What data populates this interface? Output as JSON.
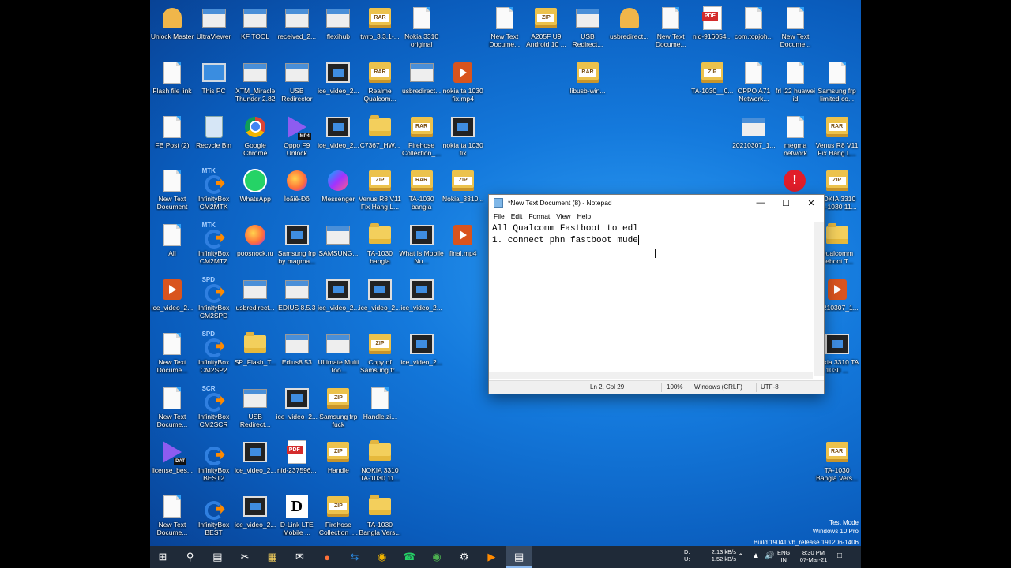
{
  "desktop": {
    "icons": [
      {
        "label": "Unlock Master",
        "icon": "unlock-master-icon",
        "type": "user"
      },
      {
        "label": "UltraViewer",
        "icon": "ultraviewer-icon",
        "type": "monitor"
      },
      {
        "label": "KF TOOL",
        "icon": "kf-tool-icon",
        "type": "tool"
      },
      {
        "label": "received_2...",
        "icon": "image-file-icon",
        "type": "image"
      },
      {
        "label": "flexihub",
        "icon": "flexihub-icon",
        "type": "tool"
      },
      {
        "label": "twrp_3.3.1-...",
        "icon": "archive-icon",
        "type": "arch"
      },
      {
        "label": "Nokia 3310 original",
        "icon": "document-icon",
        "type": "doc"
      },
      {
        "label": "New Text Docume...",
        "icon": "text-document-icon",
        "type": "doc"
      },
      {
        "label": "A205F U9 Android 10 ...",
        "icon": "zip-archive-icon",
        "type": "zip"
      },
      {
        "label": "USB Redirect...",
        "icon": "usb-redirector-icon",
        "type": "tool"
      },
      {
        "label": "usbredirect...",
        "icon": "usbredirector-icon",
        "type": "user"
      },
      {
        "label": "New Text Docume...",
        "icon": "text-document-icon",
        "type": "doc"
      },
      {
        "label": "nid-916054...",
        "icon": "pdf-icon",
        "type": "pdf"
      },
      {
        "label": "com.topjoh...",
        "icon": "document-icon",
        "type": "doc"
      },
      {
        "label": "New Text Docume...",
        "icon": "text-document-icon",
        "type": "doc"
      },
      {
        "label": "Flash file link",
        "icon": "text-document-icon",
        "type": "doc"
      },
      {
        "label": "This PC",
        "icon": "this-pc-icon",
        "type": "pc"
      },
      {
        "label": "XTM_Miracle Thunder 2.82",
        "icon": "miracle-thunder-icon",
        "type": "tool"
      },
      {
        "label": "USB Redirector",
        "icon": "usb-redirector-icon",
        "type": "tool"
      },
      {
        "label": "ice_video_2...",
        "icon": "video-icon",
        "type": "vid"
      },
      {
        "label": "Realme Qualcom...",
        "icon": "rar-archive-icon",
        "type": "rar"
      },
      {
        "label": "usbredirect...",
        "icon": "usbredirector-icon",
        "type": "tool"
      },
      {
        "label": "nokia ta 1030 fix.mp4",
        "icon": "media-file-icon",
        "type": "media"
      },
      {
        "label": "libusb-win...",
        "icon": "rar-archive-icon",
        "type": "rar"
      },
      {
        "label": "TA-1030__0...",
        "icon": "zip-archive-icon",
        "type": "zip"
      },
      {
        "label": "OPPO A71 Network...",
        "icon": "text-document-icon",
        "type": "doc"
      },
      {
        "label": "frl l22 huawei id",
        "icon": "text-document-icon",
        "type": "doc"
      },
      {
        "label": "Samsung frp limited co...",
        "icon": "text-document-icon",
        "type": "doc"
      },
      {
        "label": "FB Post (2)",
        "icon": "document-icon",
        "type": "doc"
      },
      {
        "label": "Recycle Bin",
        "icon": "recycle-bin-icon",
        "type": "bin"
      },
      {
        "label": "Google Chrome",
        "icon": "chrome-icon",
        "type": "chrome"
      },
      {
        "label": "Oppo F9 Unlock",
        "icon": "mp4-file-icon",
        "type": "mp4"
      },
      {
        "label": "ice_video_2...",
        "icon": "video-icon",
        "type": "vid"
      },
      {
        "label": "C7367_HW...",
        "icon": "folder-icon",
        "type": "folder"
      },
      {
        "label": "Firehose Collection_...",
        "icon": "rar-archive-icon",
        "type": "rar"
      },
      {
        "label": "nokia ta 1030 fix",
        "icon": "video-icon",
        "type": "vid"
      },
      {
        "label": "20210307_1...",
        "icon": "phone-image-icon",
        "type": "tool"
      },
      {
        "label": "megma network",
        "icon": "text-document-icon",
        "type": "doc"
      },
      {
        "label": "Venus R8 V11 Fix Hang L...",
        "icon": "rar-archive-icon",
        "type": "rar"
      },
      {
        "label": "New Text Document",
        "icon": "text-document-icon",
        "type": "doc"
      },
      {
        "label": "InfinityBox CM2MTK",
        "icon": "infinitybox-icon",
        "type": "ibox",
        "mark": "MTK"
      },
      {
        "label": "WhatsApp",
        "icon": "whatsapp-icon",
        "type": "wa"
      },
      {
        "label": "Ìoãiê-Ðõ",
        "icon": "firefox-icon",
        "type": "ff"
      },
      {
        "label": "Messenger",
        "icon": "messenger-icon",
        "type": "msg"
      },
      {
        "label": "Venus R8 V11 Fix Hang L...",
        "icon": "zip-archive-icon",
        "type": "zip"
      },
      {
        "label": "TA-1030 bangla",
        "icon": "rar-archive-icon",
        "type": "rar"
      },
      {
        "label": "Nokia_3310...",
        "icon": "zip-archive-icon",
        "type": "zip"
      },
      {
        "label": "NOKIA 3310 TA-1030 11...",
        "icon": "zip-archive-icon",
        "type": "zip"
      },
      {
        "label": "All",
        "icon": "text-document-icon",
        "type": "doc"
      },
      {
        "label": "InfinityBox CM2MTZ",
        "icon": "infinitybox-icon",
        "type": "ibox",
        "mark": "MTK"
      },
      {
        "label": "poosnock.ru",
        "icon": "firefox-icon",
        "type": "ff"
      },
      {
        "label": "Samsung frp by magma...",
        "icon": "image-file-icon",
        "type": "vid"
      },
      {
        "label": "SAMSUNG...",
        "icon": "samsung-tool-icon",
        "type": "tool"
      },
      {
        "label": "TA-1030 bangla",
        "icon": "folder-icon",
        "type": "folder"
      },
      {
        "label": "What Is Mobile Nu...",
        "icon": "video-icon",
        "type": "vid"
      },
      {
        "label": "final.mp4",
        "icon": "media-file-icon",
        "type": "media"
      },
      {
        "label": "Qualcomm Reboot T...",
        "icon": "folder-icon",
        "type": "folder"
      },
      {
        "label": "ice_video_2...",
        "icon": "media-file-icon",
        "type": "media"
      },
      {
        "label": "InfinityBox CM2SPD",
        "icon": "infinitybox-icon",
        "type": "ibox",
        "mark": "SPD"
      },
      {
        "label": "usbredirect...",
        "icon": "usbredirector-icon",
        "type": "tool"
      },
      {
        "label": "EDIUS 8.5.3",
        "icon": "edius-icon",
        "type": "tool"
      },
      {
        "label": "ice_video_2...",
        "icon": "video-icon",
        "type": "vid"
      },
      {
        "label": "ice_video_2...",
        "icon": "video-icon",
        "type": "vid"
      },
      {
        "label": "ice_video_2...",
        "icon": "video-icon",
        "type": "vid"
      },
      {
        "label": "20210307_1...",
        "icon": "media-file-icon",
        "type": "media"
      },
      {
        "label": "New Text Docume...",
        "icon": "text-document-icon",
        "type": "doc"
      },
      {
        "label": "InfinityBox CM2SP2",
        "icon": "infinitybox-icon",
        "type": "ibox",
        "mark": "SPD"
      },
      {
        "label": "SP_Flash_T...",
        "icon": "folder-icon",
        "type": "folder"
      },
      {
        "label": "Edius8.53",
        "icon": "edius-icon",
        "type": "tool"
      },
      {
        "label": "Ultimate Multi Too...",
        "icon": "ultimate-multi-tool-icon",
        "type": "tool"
      },
      {
        "label": "Copy of Samsung fr...",
        "icon": "zip-archive-icon",
        "type": "zip"
      },
      {
        "label": "ice_video_2...",
        "icon": "video-icon",
        "type": "vid"
      },
      {
        "label": "Nokia 3310 TA 1030 ...",
        "icon": "video-icon",
        "type": "vid"
      },
      {
        "label": "New Text Docume...",
        "icon": "text-document-icon",
        "type": "doc"
      },
      {
        "label": "InfinityBox CM2SCR",
        "icon": "infinitybox-icon",
        "type": "ibox",
        "mark": "SCR"
      },
      {
        "label": "USB Redirect...",
        "icon": "usb-redirector-icon",
        "type": "tool"
      },
      {
        "label": "ice_video_2...",
        "icon": "video-icon",
        "type": "vid"
      },
      {
        "label": "Samsung frp fuck",
        "icon": "zip-archive-icon",
        "type": "zip"
      },
      {
        "label": "Handle.zi...",
        "icon": "document-icon",
        "type": "doc"
      },
      {
        "label": "license_bes...",
        "icon": "dat-file-icon",
        "type": "mp4",
        "tag": "DAT"
      },
      {
        "label": "InfinityBox BEST2",
        "icon": "infinitybox-icon",
        "type": "ibox",
        "mark": ""
      },
      {
        "label": "ice_video_2...",
        "icon": "video-icon",
        "type": "vid"
      },
      {
        "label": "nid-237596...",
        "icon": "pdf-icon",
        "type": "pdf"
      },
      {
        "label": "Handle",
        "icon": "zip-archive-icon",
        "type": "zip"
      },
      {
        "label": "NOKIA 3310 TA-1030 11...",
        "icon": "folder-icon",
        "type": "folder"
      },
      {
        "label": "TA-1030 Bangla Vers...",
        "icon": "rar-archive-icon",
        "type": "rar"
      },
      {
        "label": "New Text Docume...",
        "icon": "text-document-icon",
        "type": "doc"
      },
      {
        "label": "InfinityBox BEST",
        "icon": "infinitybox-icon",
        "type": "ibox",
        "mark": ""
      },
      {
        "label": "ice_video_2...",
        "icon": "video-icon",
        "type": "vid"
      },
      {
        "label": "D-Link LTE Mobile ...",
        "icon": "dlink-icon",
        "type": "dlink"
      },
      {
        "label": "Firehose Collection_...",
        "icon": "zip-archive-icon",
        "type": "zip"
      },
      {
        "label": "TA-1030 Bangla Vers...",
        "icon": "folder-icon",
        "type": "folder"
      },
      {
        "label": "ice_video_2...",
        "icon": "mp4-file-icon",
        "type": "mp4",
        "tag": "MP4"
      }
    ]
  },
  "notepad": {
    "title": "*New Text Document (8) - Notepad",
    "menu": [
      "File",
      "Edit",
      "Format",
      "View",
      "Help"
    ],
    "lines": [
      "All Qualcomm Fastboot to edl",
      "1. connect phn fastboot mude"
    ],
    "status": {
      "position": "Ln 2, Col 29",
      "zoom": "100%",
      "line_ending": "Windows (CRLF)",
      "encoding": "UTF-8"
    }
  },
  "watermark": {
    "line1": "Test Mode",
    "line2": "Windows 10 Pro",
    "line3": "Build 19041.vb_release.191206-1406"
  },
  "taskbar": {
    "apps": [
      "start-icon",
      "search-icon",
      "task-view-icon",
      "snipping-icon",
      "file-explorer-icon",
      "mail-icon",
      "firefox-icon",
      "teamviewer-icon",
      "chrome-canary-icon",
      "whatsapp-icon",
      "chrome-icon",
      "tool-icon",
      "media-player-icon",
      "notepad-icon"
    ],
    "drive_c": "D:",
    "drive_u": "U:",
    "net_down": "2.13 kB/s",
    "net_up": "1.52 kB/s",
    "lang": "ENG",
    "region": "IN",
    "time": "8:30 PM",
    "date": "07-Mar-21"
  },
  "colors": {
    "accent": "#1479dc",
    "taskbar": "#1f2a38"
  }
}
